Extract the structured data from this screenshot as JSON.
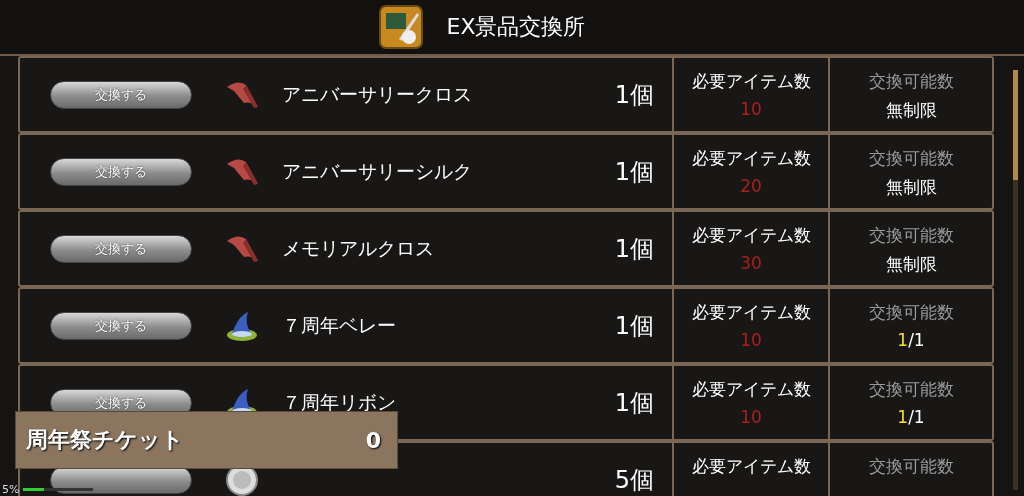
{
  "header": {
    "title": "EX景品交換所"
  },
  "items": [
    {
      "button": "交換する",
      "kind": "cloth",
      "name": "アニバーサリークロス",
      "quantity": "1個",
      "required_label": "必要アイテム数",
      "required": "10",
      "available_label": "交換可能数",
      "available": {
        "kind": "text",
        "text": "無制限"
      }
    },
    {
      "button": "交換する",
      "kind": "cloth",
      "name": "アニバーサリーシルク",
      "quantity": "1個",
      "required_label": "必要アイテム数",
      "required": "20",
      "available_label": "交換可能数",
      "available": {
        "kind": "text",
        "text": "無制限"
      }
    },
    {
      "button": "交換する",
      "kind": "cloth",
      "name": "メモリアルクロス",
      "quantity": "1個",
      "required_label": "必要アイテム数",
      "required": "30",
      "available_label": "交換可能数",
      "available": {
        "kind": "text",
        "text": "無制限"
      }
    },
    {
      "button": "交換する",
      "kind": "hat",
      "name": "７周年ベレー",
      "quantity": "1個",
      "required_label": "必要アイテム数",
      "required": "10",
      "available_label": "交換可能数",
      "available": {
        "kind": "count",
        "current": "1",
        "rest": "/1"
      }
    },
    {
      "button": "交換する",
      "kind": "hat",
      "name": "７周年リボン",
      "quantity": "1個",
      "required_label": "必要アイテム数",
      "required": "10",
      "available_label": "交換可能数",
      "available": {
        "kind": "count",
        "current": "1",
        "rest": "/1"
      }
    },
    {
      "kind": "medal",
      "quantity": "5個",
      "required_label": "必要アイテム数",
      "available_label": "交換可能数"
    }
  ],
  "ticket": {
    "label": "周年祭チケット",
    "count": "0"
  },
  "status": {
    "text": "5%",
    "level": 0.3
  }
}
